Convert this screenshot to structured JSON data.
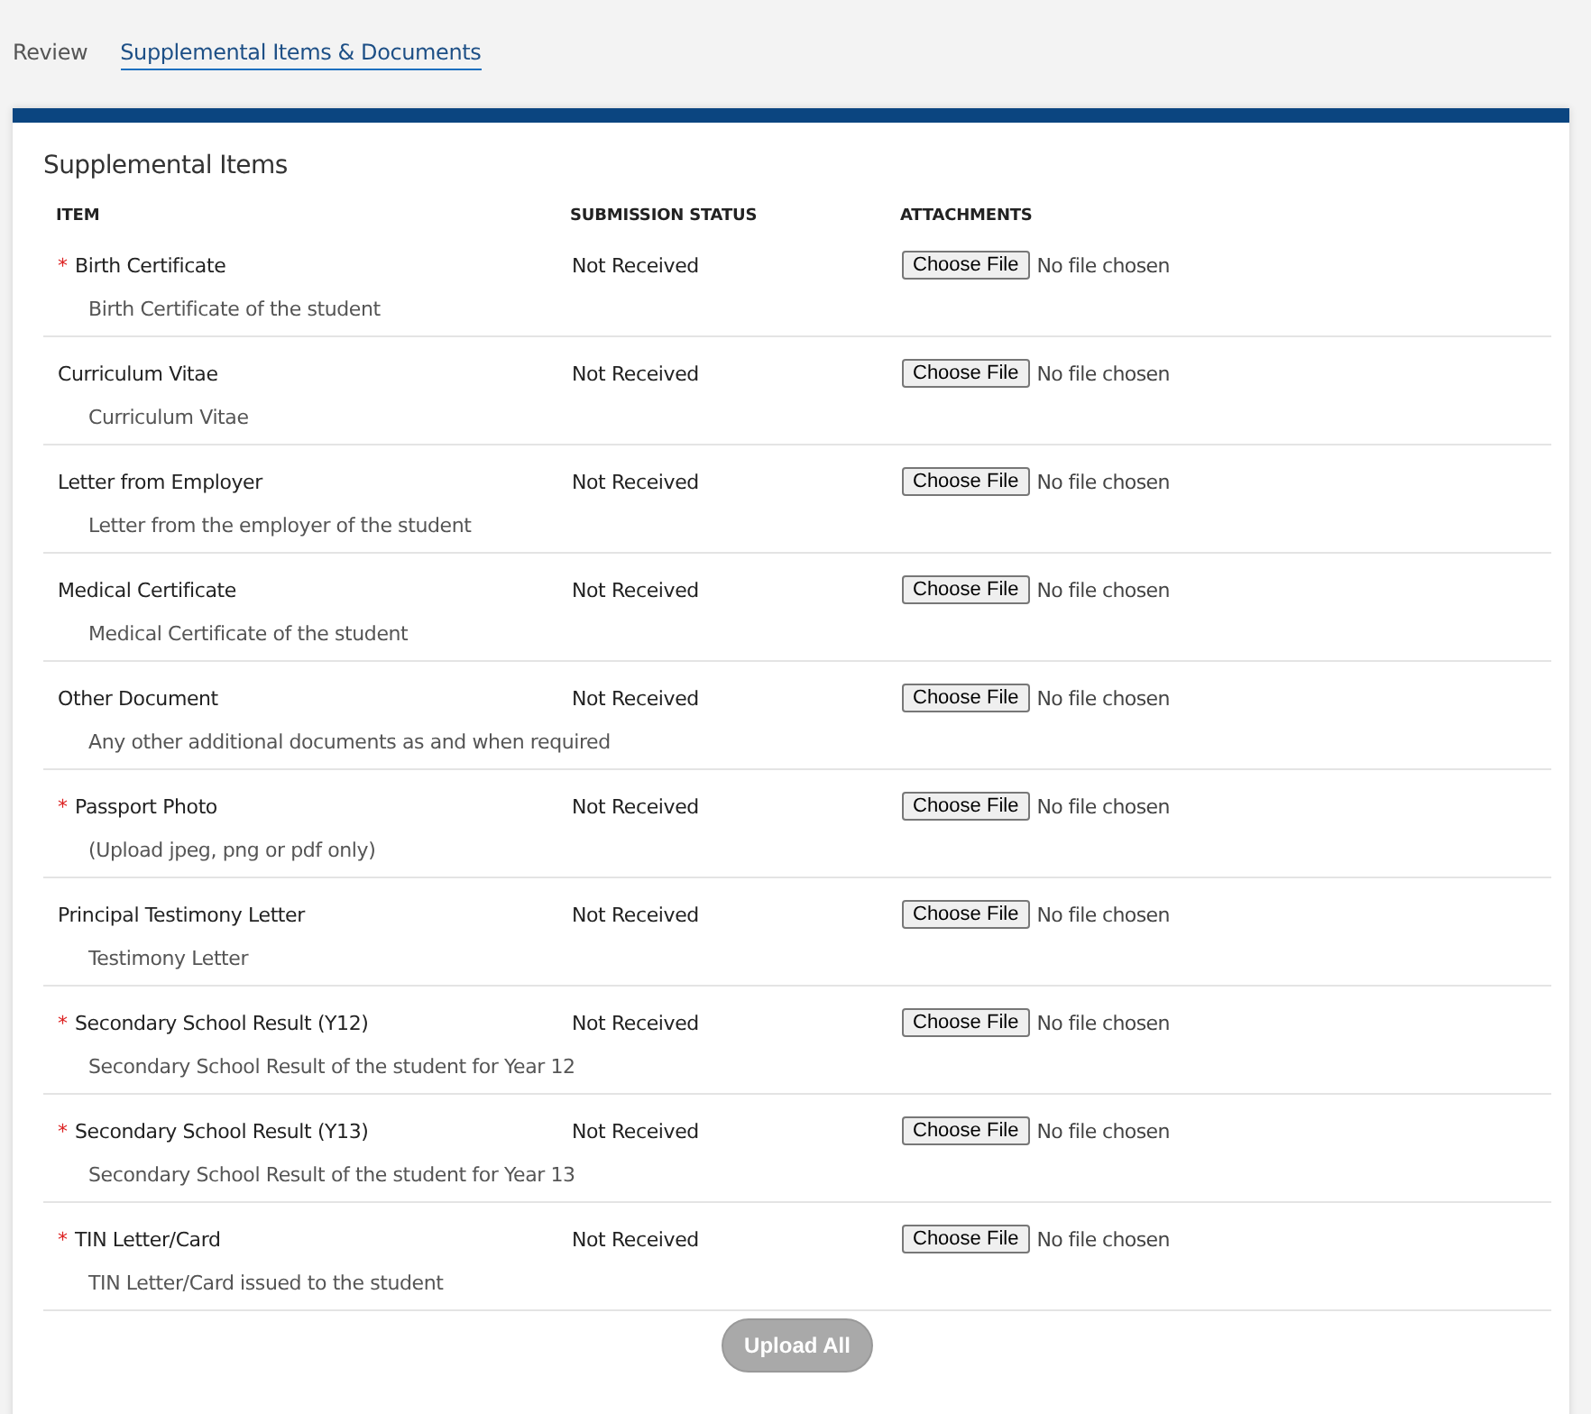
{
  "tabs": [
    {
      "label": "Review",
      "selected": false
    },
    {
      "label": "Supplemental Items & Documents",
      "selected": true
    }
  ],
  "section": {
    "title": "Supplemental Items",
    "columns": [
      "ITEM",
      "SUBMISSION STATUS",
      "ATTACHMENTS"
    ],
    "rows": [
      {
        "required_mark": "*",
        "name": "Birth Certificate",
        "description": "Birth Certificate of the student",
        "status": "Not Received",
        "button": "Choose File",
        "file": "No file chosen"
      },
      {
        "name": "Curriculum Vitae",
        "description": "Curriculum Vitae",
        "status": "Not Received",
        "button": "Choose File",
        "file": "No file chosen"
      },
      {
        "name": "Letter from Employer",
        "description": "Letter from the employer of the student",
        "status": "Not Received",
        "button": "Choose File",
        "file": "No file chosen"
      },
      {
        "name": "Medical Certificate",
        "description": "Medical Certificate of the student",
        "status": "Not Received",
        "button": "Choose File",
        "file": "No file chosen"
      },
      {
        "name": "Other Document",
        "description": "Any other additional documents as and when required",
        "status": "Not Received",
        "button": "Choose File",
        "file": "No file chosen"
      },
      {
        "required_mark": "*",
        "name": "Passport Photo",
        "description": "(Upload jpeg, png or pdf only)",
        "status": "Not Received",
        "button": "Choose File",
        "file": "No file chosen"
      },
      {
        "name": "Principal Testimony Letter",
        "description": "Testimony Letter",
        "status": "Not Received",
        "button": "Choose File",
        "file": "No file chosen"
      },
      {
        "required_mark": "*",
        "name": "Secondary School Result (Y12)",
        "description": "Secondary School Result of the student for Year 12",
        "status": "Not Received",
        "button": "Choose File",
        "file": "No file chosen"
      },
      {
        "required_mark": "*",
        "name": "Secondary School Result (Y13)",
        "description": "Secondary School Result of the student for Year 13",
        "status": "Not Received",
        "button": "Choose File",
        "file": "No file chosen"
      },
      {
        "required_mark": "*",
        "name": "TIN Letter/Card",
        "description": "TIN Letter/Card issued to the student",
        "status": "Not Received",
        "button": "Choose File",
        "file": "No file chosen"
      }
    ],
    "upload_button": {
      "label": "Upload All",
      "disabled": true
    }
  }
}
